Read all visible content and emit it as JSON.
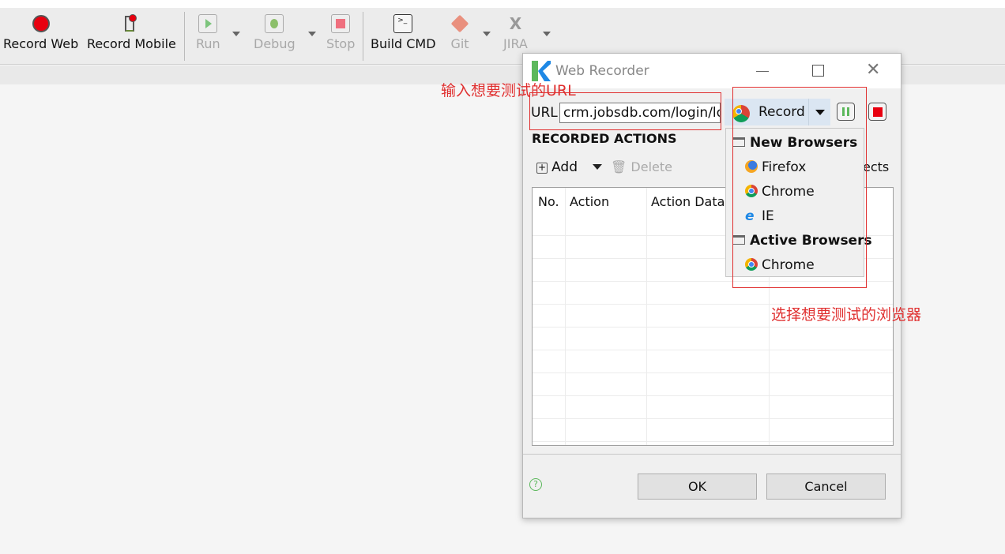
{
  "toolbar": {
    "items": [
      {
        "label": "Record Web",
        "icon": "record-icon",
        "enabled": true
      },
      {
        "label": "Record Mobile",
        "icon": "record-mobile-icon",
        "enabled": true
      },
      {
        "label": "Run",
        "icon": "run-icon",
        "enabled": false
      },
      {
        "label": "Debug",
        "icon": "debug-icon",
        "enabled": false
      },
      {
        "label": "Stop",
        "icon": "stop-icon",
        "enabled": false
      },
      {
        "label": "Build CMD",
        "icon": "terminal-icon",
        "enabled": true
      },
      {
        "label": "Git",
        "icon": "git-icon",
        "enabled": false
      },
      {
        "label": "JIRA",
        "icon": "jira-icon",
        "enabled": false
      }
    ]
  },
  "dialog": {
    "title": "Web Recorder",
    "url_label": "URL",
    "url_value": "crm.jobsdb.com/login/lo",
    "record_label": "Record",
    "section_title": "RECORDED ACTIONS",
    "add_label": "Add",
    "delete_label": "Delete",
    "objects_partial": "ects",
    "table": {
      "columns": [
        "No.",
        "Action",
        "Action Data"
      ],
      "rows": []
    },
    "ok_label": "OK",
    "cancel_label": "Cancel",
    "browser_menu": {
      "new_header": "New Browsers",
      "new_items": [
        "Firefox",
        "Chrome",
        "IE"
      ],
      "active_header": "Active Browsers",
      "active_items": [
        "Chrome"
      ]
    }
  },
  "annotations": {
    "url_note": "输入想要测试的URL",
    "browser_note": "选择想要测试的浏览器"
  },
  "colors": {
    "annotation": "#e03030",
    "record": "#e8000f",
    "accent": "#dbe6f2"
  }
}
